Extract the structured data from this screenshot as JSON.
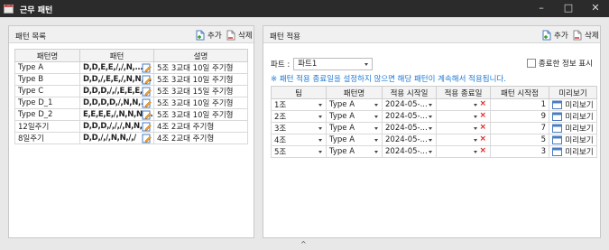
{
  "window": {
    "title": "근무 패턴"
  },
  "left_panel": {
    "title": "패턴 목록",
    "add_label": "추가",
    "delete_label": "삭제",
    "columns": [
      "패턴명",
      "패턴",
      "설명"
    ],
    "rows": [
      {
        "name": "Type A",
        "pattern": "D,D,E,E,/,/,N,...",
        "desc": "5조 3교대 10일 주기형"
      },
      {
        "name": "Type B",
        "pattern": "D,D,/,E,E,/,N,N,...",
        "desc": "5조 3교대 10일 주기형"
      },
      {
        "name": "Type C",
        "pattern": "D,D,D,/,/,E,E,E,...",
        "desc": "5조 3교대 15일 주기형"
      },
      {
        "name": "Type D_1",
        "pattern": "D,D,D,D,/,N,N,...",
        "desc": "5조 3교대 10일 주기형"
      },
      {
        "name": "Type D_2",
        "pattern": "E,E,E,E,/,N,N,N,...",
        "desc": "5조 3교대 10일 주기형"
      },
      {
        "name": "12일주기",
        "pattern": "D,D,D,/,/,/,N,N,...",
        "desc": "4조 2교대 주기형"
      },
      {
        "name": "8일주기",
        "pattern": "D,D,/,/,N,N,/,/",
        "desc": "4조 2교대 주기형"
      }
    ]
  },
  "right_panel": {
    "title": "패턴 적용",
    "add_label": "추가",
    "delete_label": "삭제",
    "part_label": "파트 :",
    "part_value": "파트1",
    "show_finished_label": "종료한 정보 표시",
    "notice": "※ 패턴 적용 종료일을 설정하지 않으면 해당 패턴이 계속해서 적용됩니다.",
    "columns": [
      "팀",
      "패턴명",
      "적용 시작일",
      "적용 종료일",
      "패턴 시작점",
      "미리보기"
    ],
    "rows": [
      {
        "team": "1조",
        "pattern": "Type A",
        "start": "2024-05-...",
        "end": "",
        "start_point": "1",
        "preview": "미리보기"
      },
      {
        "team": "2조",
        "pattern": "Type A",
        "start": "2024-05-...",
        "end": "",
        "start_point": "9",
        "preview": "미리보기"
      },
      {
        "team": "3조",
        "pattern": "Type A",
        "start": "2024-05-...",
        "end": "",
        "start_point": "7",
        "preview": "미리보기"
      },
      {
        "team": "4조",
        "pattern": "Type A",
        "start": "2024-05-...",
        "end": "",
        "start_point": "5",
        "preview": "미리보기"
      },
      {
        "team": "5조",
        "pattern": "Type A",
        "start": "2024-05-...",
        "end": "",
        "start_point": "3",
        "preview": "미리보기"
      }
    ]
  },
  "colors": {
    "titlebar": "#2b2b2b",
    "notice": "#1e7bd6",
    "clear_x": "#e02020"
  }
}
